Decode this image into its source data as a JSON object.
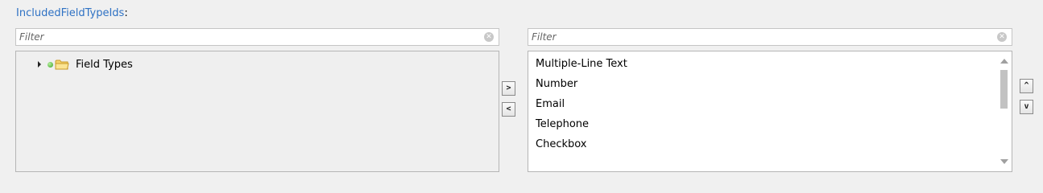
{
  "field": {
    "name": "IncludedFieldTypeIds",
    "colon": ":"
  },
  "left_filter": {
    "placeholder": "Filter",
    "value": ""
  },
  "right_filter": {
    "placeholder": "Filter",
    "value": ""
  },
  "tree": {
    "root": {
      "label": "Field Types",
      "expanded": false
    }
  },
  "selected_list": {
    "items": [
      "Multiple-Line Text",
      "Number",
      "Email",
      "Telephone",
      "Checkbox"
    ]
  },
  "buttons": {
    "add": ">",
    "remove": "<",
    "move_up": "^",
    "move_down": "v"
  },
  "colors": {
    "label_link": "#2f72c4"
  },
  "icons": {
    "clear": "clear-circle-icon",
    "expander": "triangle-right-icon",
    "status": "green-dot-icon",
    "folder": "folder-icon"
  }
}
